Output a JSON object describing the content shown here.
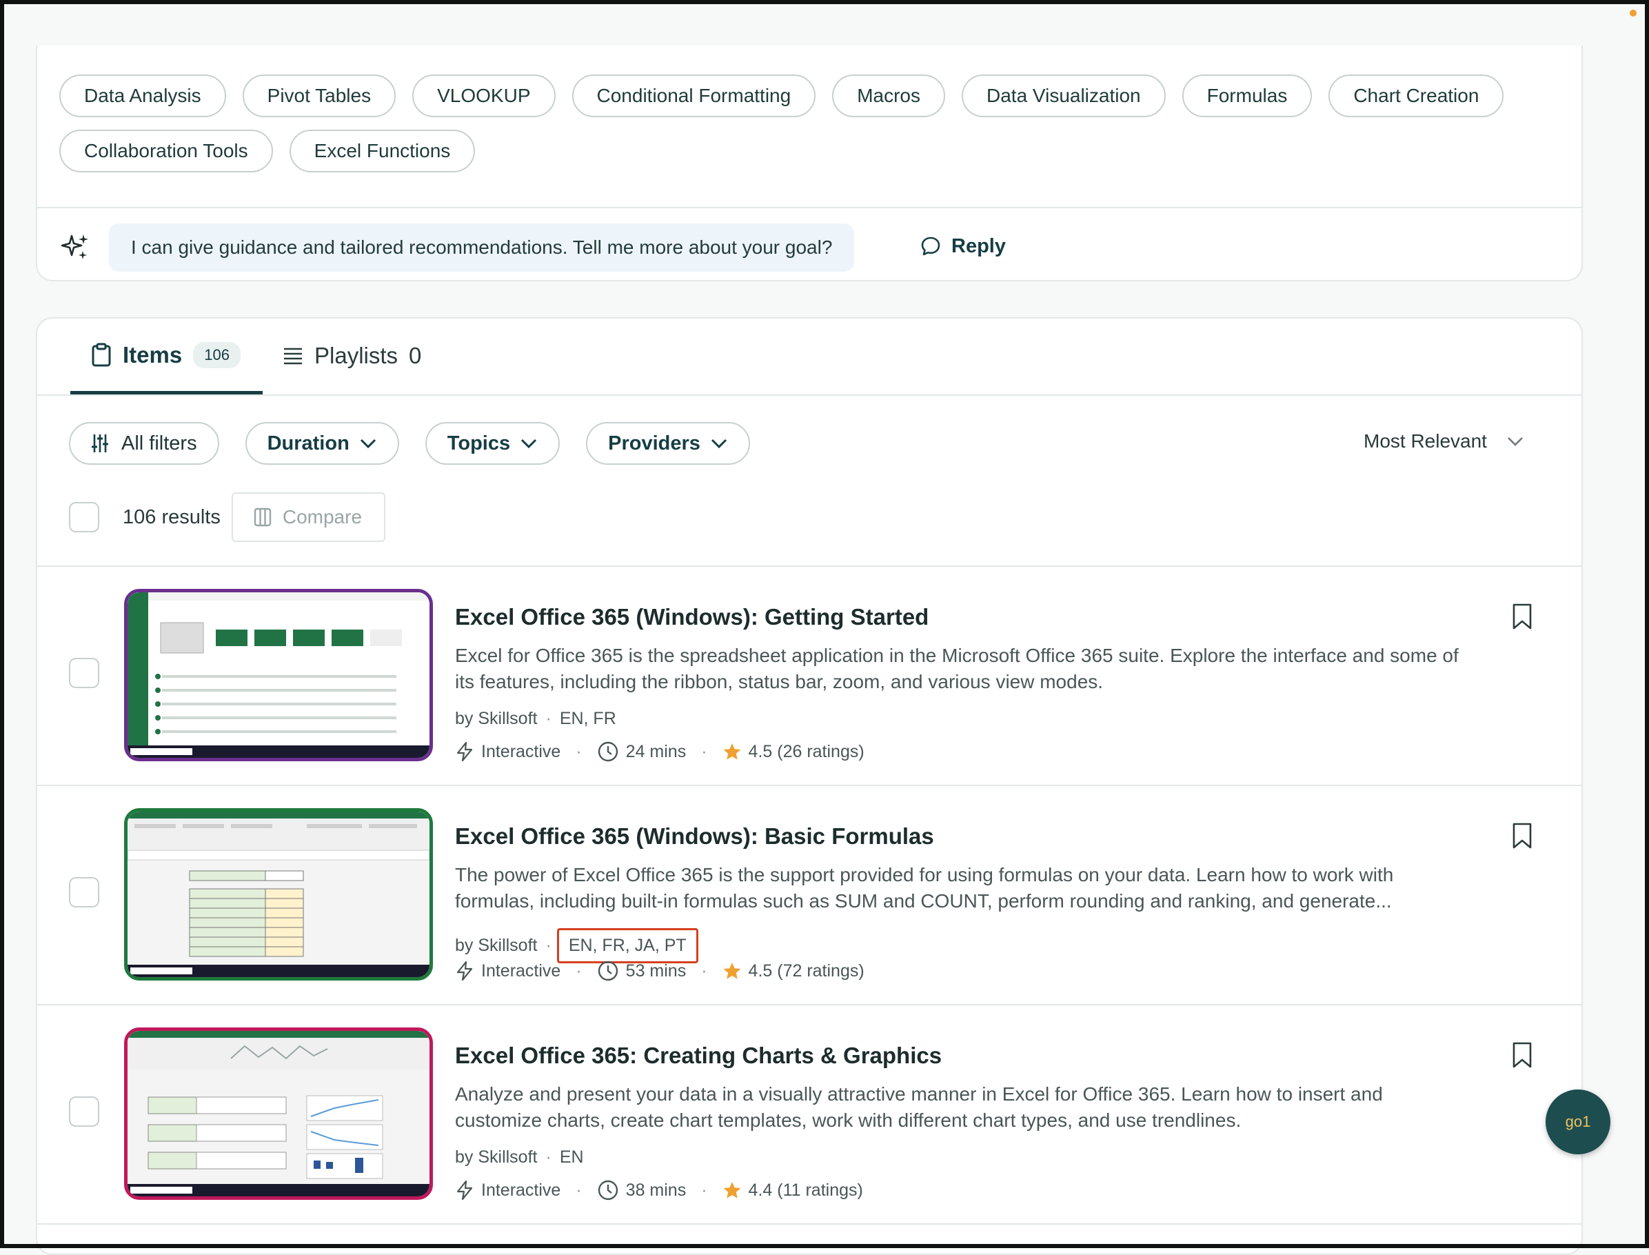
{
  "topic_chips": [
    "Data Analysis",
    "Pivot Tables",
    "VLOOKUP",
    "Conditional Formatting",
    "Macros",
    "Data Visualization",
    "Formulas",
    "Chart Creation",
    "Collaboration Tools",
    "Excel Functions"
  ],
  "assistant": {
    "message": "I can give guidance and tailored recommendations. Tell me more about your goal?",
    "reply_label": "Reply"
  },
  "tabs": {
    "items_label": "Items",
    "items_count": "106",
    "playlists_label": "Playlists",
    "playlists_count": "0"
  },
  "filters": {
    "all_filters": "All filters",
    "duration": "Duration",
    "topics": "Topics",
    "providers": "Providers",
    "sort": "Most Relevant"
  },
  "results": {
    "count_label": "106 results",
    "compare_label": "Compare"
  },
  "items": [
    {
      "title": "Excel Office 365 (Windows): Getting Started",
      "description": "Excel for Office 365 is the spreadsheet application in the Microsoft Office 365 suite. Explore the interface and some of its features, including the ribbon, status bar, zoom, and various view modes.",
      "provider": "by Skillsoft",
      "languages": "EN, FR",
      "type": "Interactive",
      "duration": "24 mins",
      "rating": "4.5 (26 ratings)",
      "thumb_color": "#6a2f8e"
    },
    {
      "title": "Excel Office 365 (Windows): Basic Formulas",
      "description": "The power of Excel Office 365 is the support provided for using formulas on your data. Learn how to work with formulas, including built-in formulas such as SUM and COUNT, perform rounding and ranking, and generate...",
      "provider": "by Skillsoft",
      "languages": "EN, FR, JA, PT",
      "type": "Interactive",
      "duration": "53 mins",
      "rating": "4.5 (72 ratings)",
      "thumb_color": "#1e7a3c"
    },
    {
      "title": "Excel Office 365: Creating Charts & Graphics",
      "description": "Analyze and present your data in a visually attractive manner in Excel for Office 365. Learn how to insert and customize charts, create chart templates, work with different chart types, and use trendlines.",
      "provider": "by Skillsoft",
      "languages": "EN",
      "type": "Interactive",
      "duration": "38 mins",
      "rating": "4.4 (11 ratings)",
      "thumb_color": "#c2185b"
    }
  ],
  "assistant_fab": "go1",
  "colors": {
    "accent": "#163d44",
    "highlight": "#d4401f",
    "star": "#f0a030"
  }
}
